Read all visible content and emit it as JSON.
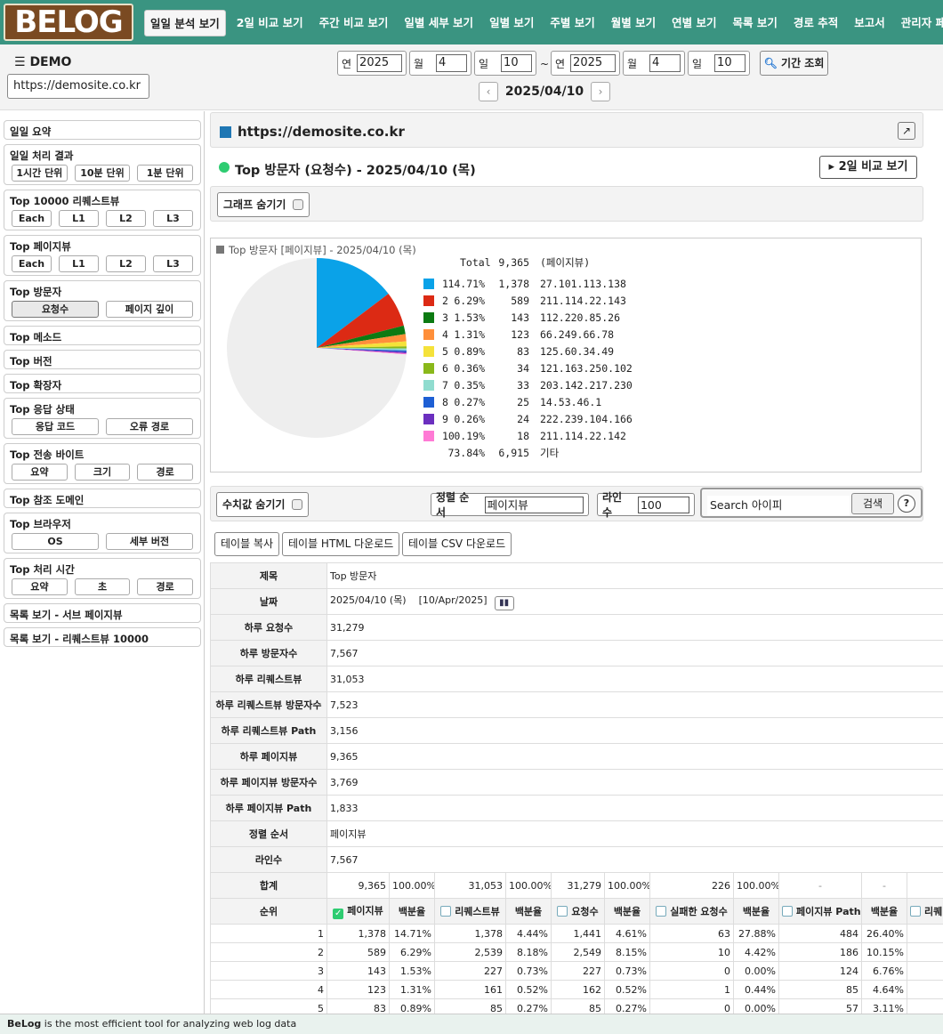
{
  "logo": "BELOG",
  "nav": [
    "일일 분석 보기",
    "2일 비교 보기",
    "주간 비교 보기",
    "일별 세부 보기",
    "일별 보기",
    "주별 보기",
    "월별 보기",
    "연별 보기",
    "목록 보기",
    "경로 추적",
    "보고서",
    "관리자 페이지"
  ],
  "header": {
    "demo_title": "DEMO",
    "site": "https://demosite.co.kr"
  },
  "period": {
    "from_year_label": "연",
    "from_year": "2025",
    "from_month_label": "월",
    "from_month": "4",
    "from_day_label": "일",
    "from_day": "10",
    "tilde": "~",
    "to_year_label": "연",
    "to_year": "2025",
    "to_month_label": "월",
    "to_month": "4",
    "to_day_label": "일",
    "to_day": "10",
    "button": "기간 조회",
    "current_date": "2025/04/10"
  },
  "sidebar": [
    {
      "title": "일일 요약",
      "buttons": []
    },
    {
      "title": "일일 처리 결과",
      "buttons": [
        "1시간 단위",
        "10분 단위",
        "1분 단위"
      ]
    },
    {
      "title": "Top 10000 리퀘스트뷰",
      "buttons": [
        "Each",
        "L1",
        "L2",
        "L3"
      ]
    },
    {
      "title": "Top 페이지뷰",
      "buttons": [
        "Each",
        "L1",
        "L2",
        "L3"
      ]
    },
    {
      "title": "Top 방문자",
      "buttons": [
        "요청수",
        "페이지 깊이"
      ]
    },
    {
      "title": "Top 메소드",
      "buttons": []
    },
    {
      "title": "Top 버전",
      "buttons": []
    },
    {
      "title": "Top 확장자",
      "buttons": []
    },
    {
      "title": "Top 응답 상태",
      "buttons": [
        "응답 코드",
        "오류 경로"
      ]
    },
    {
      "title": "Top 전송 바이트",
      "buttons": [
        "요약",
        "크기",
        "경로"
      ]
    },
    {
      "title": "Top 참조 도메인",
      "buttons": []
    },
    {
      "title": "Top 브라우저",
      "buttons": [
        "OS",
        "세부 버전"
      ]
    },
    {
      "title": "Top 처리 시간",
      "buttons": [
        "요약",
        "초",
        "경로"
      ]
    },
    {
      "title": "목록 보기 - 서브 페이지뷰",
      "buttons": []
    },
    {
      "title": "목록 보기 - 리퀘스트뷰 10000",
      "buttons": []
    }
  ],
  "main": {
    "url": "https://demosite.co.kr",
    "ext_icon": "↗",
    "section_title": "Top 방문자 (요청수) - 2025/04/10 (목)",
    "compare_button": "▸ 2일 비교 보기",
    "hide_graph": "그래프 숨기기",
    "hide_values": "수치값 숨기기",
    "sort_label": "정렬 순서",
    "sort_value": "페이지뷰",
    "lines_label": "라인수",
    "lines_value": "100",
    "search_placeholder": "Search 아이피",
    "search_button": "검색",
    "help": "?",
    "copy_table": "테이블 복사",
    "html_download": "테이블 HTML 다운로드",
    "csv_download": "테이블 CSV 다운로드"
  },
  "chart_data": {
    "type": "pie",
    "title": "Top 방문자 [페이지뷰] - 2025/04/10 (목)",
    "total_label": "Total",
    "total_value": "9,365",
    "total_unit": "(페이지뷰)",
    "slices": [
      {
        "rank": "1",
        "pct": "14.71%",
        "value": 1378,
        "value_text": "1,378",
        "label": "27.101.113.138",
        "color": "#0aa2e8"
      },
      {
        "rank": "2",
        "pct": "6.29%",
        "value": 589,
        "value_text": "589",
        "label": "211.114.22.143",
        "color": "#dc2a14"
      },
      {
        "rank": "3",
        "pct": "1.53%",
        "value": 143,
        "value_text": "143",
        "label": "112.220.85.26",
        "color": "#0c7a12"
      },
      {
        "rank": "4",
        "pct": "1.31%",
        "value": 123,
        "value_text": "123",
        "label": "66.249.66.78",
        "color": "#ff8f3a"
      },
      {
        "rank": "5",
        "pct": "0.89%",
        "value": 83,
        "value_text": "83",
        "label": "125.60.34.49",
        "color": "#f5e23a"
      },
      {
        "rank": "6",
        "pct": "0.36%",
        "value": 34,
        "value_text": "34",
        "label": "121.163.250.102",
        "color": "#8ab81a"
      },
      {
        "rank": "7",
        "pct": "0.35%",
        "value": 33,
        "value_text": "33",
        "label": "203.142.217.230",
        "color": "#90dccf"
      },
      {
        "rank": "8",
        "pct": "0.27%",
        "value": 25,
        "value_text": "25",
        "label": "14.53.46.1",
        "color": "#1e5fd4"
      },
      {
        "rank": "9",
        "pct": "0.26%",
        "value": 24,
        "value_text": "24",
        "label": "222.239.104.166",
        "color": "#6b2fbf"
      },
      {
        "rank": "10",
        "pct": "0.19%",
        "value": 18,
        "value_text": "18",
        "label": "211.114.22.142",
        "color": "#ff7ad5"
      }
    ],
    "other": {
      "pct": "73.84%",
      "value": 6915,
      "value_text": "6,915",
      "label": "기타",
      "color": "#eeeeee"
    }
  },
  "summary": [
    {
      "k": "제목",
      "v": "Top 방문자"
    },
    {
      "k": "날짜",
      "v": "2025/04/10 (목)    [10/Apr/2025]"
    },
    {
      "k": "하루 요청수",
      "v": "31,279"
    },
    {
      "k": "하루 방문자수",
      "v": "7,567"
    },
    {
      "k": "하루 리퀘스트뷰",
      "v": "31,053"
    },
    {
      "k": "하루 리퀘스트뷰 방문자수",
      "v": "7,523"
    },
    {
      "k": "하루 리퀘스트뷰 Path",
      "v": "3,156"
    },
    {
      "k": "하루 페이지뷰",
      "v": "9,365"
    },
    {
      "k": "하루 페이지뷰 방문자수",
      "v": "3,769"
    },
    {
      "k": "하루 페이지뷰 Path",
      "v": "1,833"
    },
    {
      "k": "정렬 순서",
      "v": "페이지뷰"
    },
    {
      "k": "라인수",
      "v": "7,567"
    }
  ],
  "totals": {
    "label": "합계",
    "cells": [
      "9,365",
      "100.00%",
      "31,053",
      "100.00%",
      "31,279",
      "100.00%",
      "226",
      "100.00%",
      "-",
      "-"
    ]
  },
  "columns": {
    "rank": "순위",
    "headers": [
      "페이지뷰",
      "백분율",
      "리퀘스트뷰",
      "백분율",
      "요청수",
      "백분율",
      "실패한 요청수",
      "백분율",
      "페이지뷰 Path",
      "백분율",
      "리퀘"
    ]
  },
  "rows": [
    [
      "1",
      "1,378",
      "14.71%",
      "1,378",
      "4.44%",
      "1,441",
      "4.61%",
      "63",
      "27.88%",
      "484",
      "26.40%"
    ],
    [
      "2",
      "589",
      "6.29%",
      "2,539",
      "8.18%",
      "2,549",
      "8.15%",
      "10",
      "4.42%",
      "186",
      "10.15%"
    ],
    [
      "3",
      "143",
      "1.53%",
      "227",
      "0.73%",
      "227",
      "0.73%",
      "0",
      "0.00%",
      "124",
      "6.76%"
    ],
    [
      "4",
      "123",
      "1.31%",
      "161",
      "0.52%",
      "162",
      "0.52%",
      "1",
      "0.44%",
      "85",
      "4.64%"
    ],
    [
      "5",
      "83",
      "0.89%",
      "85",
      "0.27%",
      "85",
      "0.27%",
      "0",
      "0.00%",
      "57",
      "3.11%"
    ]
  ],
  "footer": {
    "brand": "BeLog",
    "text": " is the most efficient tool for analyzing web log data"
  }
}
